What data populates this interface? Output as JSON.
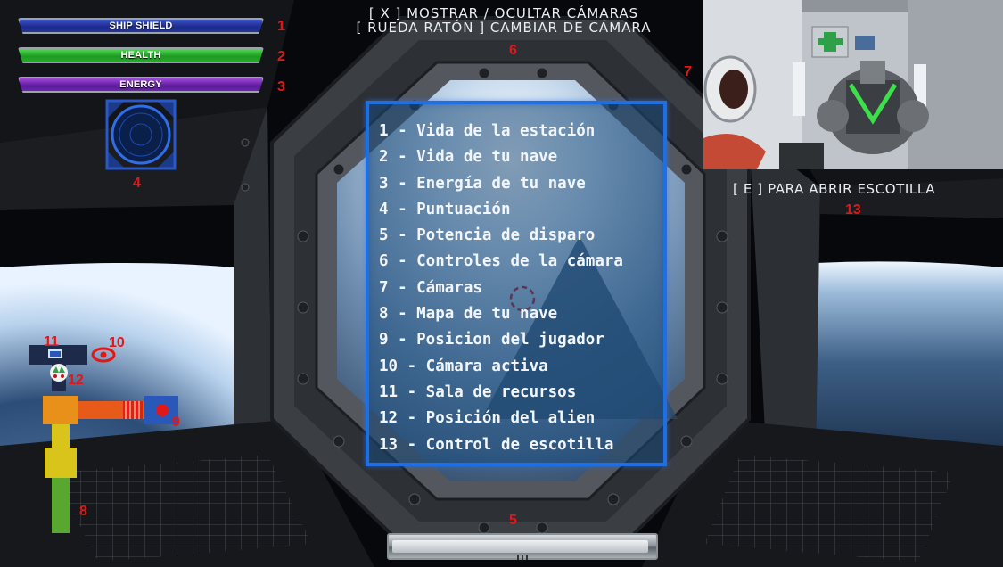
{
  "hud": {
    "ship_shield_label": "SHIP SHIELD",
    "health_label": "HEALTH",
    "energy_label": "ENERGY",
    "shield_level": 1.0,
    "health_level": 1.0,
    "energy_level": 1.0
  },
  "camera_controls": {
    "toggle_text": "[ X ] MOSTRAR / OCULTAR CÁMARAS",
    "switch_text": "[ RUEDA RATÓN ] CAMBIAR DE CÁMARA"
  },
  "hatch_prompt": "[ E ]  PARA ABRIR ESCOTILLA",
  "legend": {
    "items": [
      "1 - Vida de la estación",
      "2 - Vida de tu nave",
      "3 - Energía de tu nave",
      "4 - Puntuación",
      "5 - Potencia de disparo",
      "6 - Controles de la cámara",
      "7 - Cámaras",
      "8 - Mapa de tu nave",
      "9 - Posicion del jugador",
      "10 - Cámara activa",
      "11 - Sala de recursos",
      "12 - Posición del alien",
      "13 - Control de escotilla"
    ]
  },
  "markers": {
    "m1": "1",
    "m2": "2",
    "m3": "3",
    "m4": "4",
    "m5": "5",
    "m6": "6",
    "m7": "7",
    "m8": "8",
    "m9": "9",
    "m10": "10",
    "m11": "11",
    "m12": "12",
    "m13": "13"
  },
  "shot_power": {
    "level": 0.97
  },
  "colors": {
    "marker_red": "#e01818",
    "legend_border": "#1f6fe0",
    "shield_blue": "#24369c",
    "health_green": "#2aa82d",
    "energy_purple": "#6c24ad",
    "map_orange": "#e8901a",
    "map_yellow": "#d8c41a",
    "map_green": "#58a830",
    "player_blue": "#2a58b8"
  },
  "icons": {
    "score": "radar-circle-icon",
    "active_camera": "eye-icon",
    "resource_room": "crate-icon",
    "alien": "alien-head-icon",
    "player": "player-dot-icon",
    "crosshair": "crosshair-icon"
  }
}
